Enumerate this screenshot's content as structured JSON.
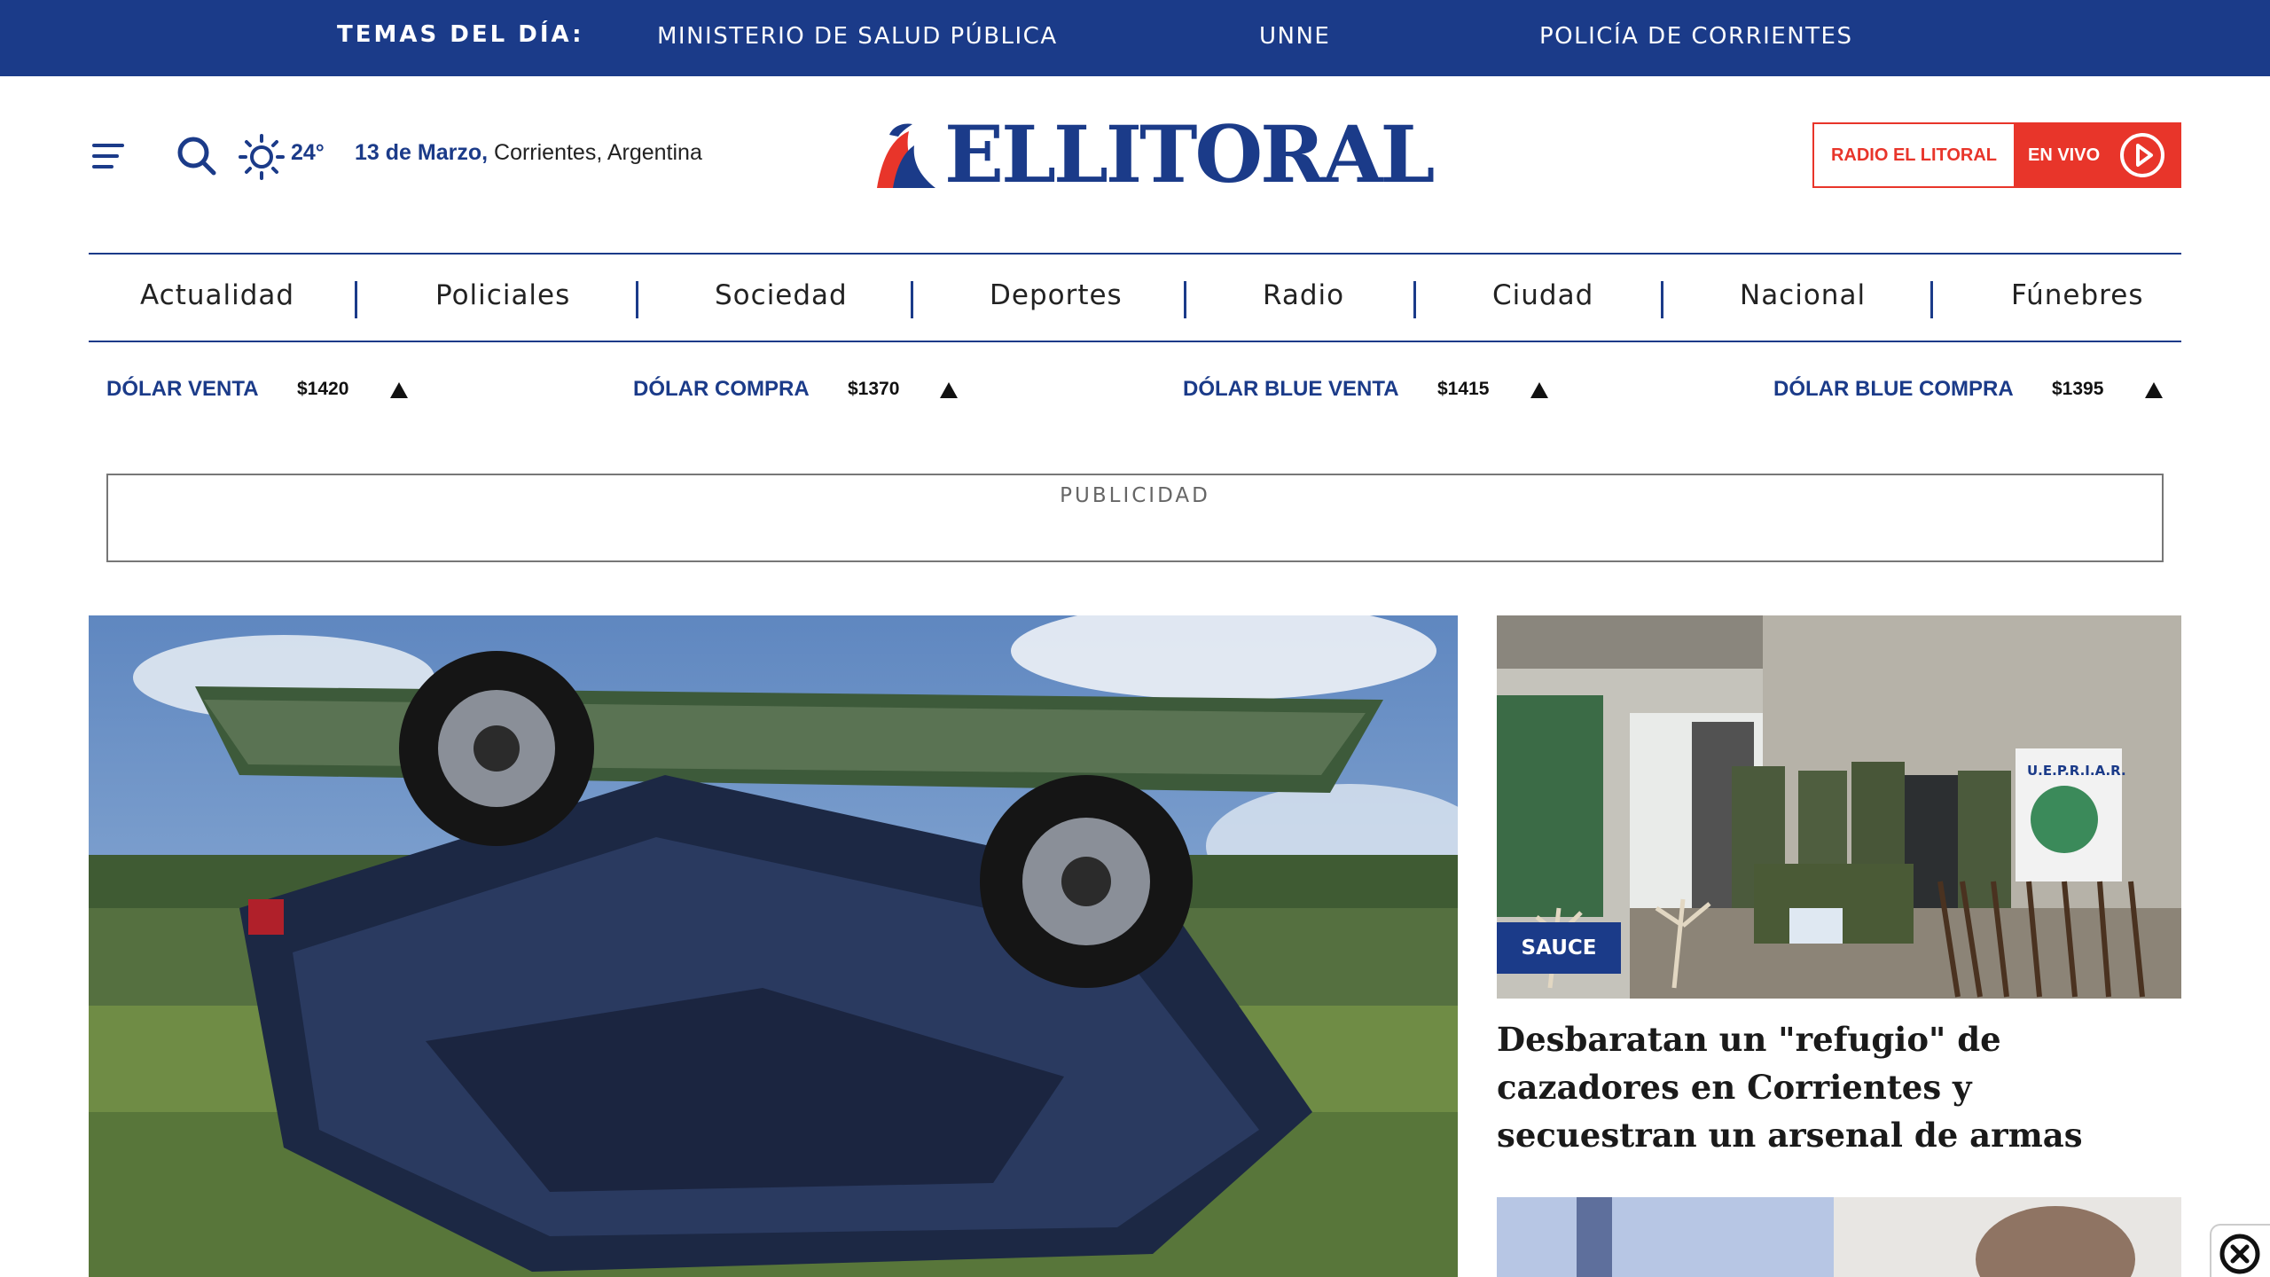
{
  "topbar": {
    "label": "TEMAS DEL DÍA:",
    "topics": [
      "MINISTERIO DE SALUD PÚBLICA",
      "UNNE",
      "POLICÍA DE CORRIENTES"
    ]
  },
  "header": {
    "temperature": "24°",
    "date_bold": "13 de Marzo,",
    "location": " Corrientes, Argentina",
    "logo_text": "ELLITORAL",
    "radio_label": "RADIO EL LITORAL",
    "live_label": "EN VIVO"
  },
  "nav": {
    "items": [
      "Actualidad",
      "Policiales",
      "Sociedad",
      "Deportes",
      "Radio",
      "Ciudad",
      "Nacional",
      "Fúnebres"
    ]
  },
  "fx": [
    {
      "name": "DÓLAR VENTA",
      "value": "$1420"
    },
    {
      "name": "DÓLAR COMPRA",
      "value": "$1370"
    },
    {
      "name": "DÓLAR BLUE VENTA",
      "value": "$1415"
    },
    {
      "name": "DÓLAR BLUE COMPRA",
      "value": "$1395"
    }
  ],
  "ad": {
    "label": "PUBLICIDAD"
  },
  "side_story": {
    "tag": "SAUCE",
    "title": "Desbaratan un \"refugio\" de cazadores en Corrientes y secuestran un arsenal de armas",
    "sign_text": "U.E.P.R.I.A.R."
  },
  "colors": {
    "brand_blue": "#1b3b89",
    "accent_red": "#e8352a"
  },
  "icons": [
    "menu-icon",
    "search-icon",
    "sun-icon",
    "play-icon",
    "close-icon"
  ]
}
